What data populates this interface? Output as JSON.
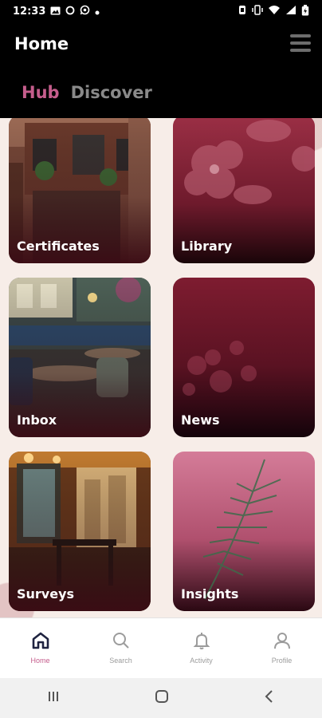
{
  "status_bar": {
    "time": "12:33",
    "left_icons": [
      "image-icon",
      "circle-icon",
      "whatsapp-icon",
      "dot-icon"
    ],
    "right_icons": [
      "alarm-icon",
      "vibrate-icon",
      "wifi-icon",
      "signal-icon",
      "battery-icon"
    ]
  },
  "header": {
    "title": "Home",
    "menu_icon": "hamburger-menu-icon"
  },
  "tabs": [
    {
      "label": "Hub",
      "active": true
    },
    {
      "label": "Discover",
      "active": false
    }
  ],
  "cards": [
    {
      "id": "certificates",
      "label": "Certificates"
    },
    {
      "id": "library",
      "label": "Library"
    },
    {
      "id": "inbox",
      "label": "Inbox"
    },
    {
      "id": "news",
      "label": "News"
    },
    {
      "id": "surveys",
      "label": "Surveys"
    },
    {
      "id": "insights",
      "label": "Insights"
    }
  ],
  "bottom_nav": [
    {
      "label": "Home",
      "icon": "home-icon",
      "active": true
    },
    {
      "label": "Search",
      "icon": "search-icon",
      "active": false
    },
    {
      "label": "Activity",
      "icon": "bell-icon",
      "active": false
    },
    {
      "label": "Profile",
      "icon": "person-icon",
      "active": false
    }
  ],
  "android_nav": [
    "recents-icon",
    "home-button-icon",
    "back-icon"
  ],
  "colors": {
    "accent": "#c55d8c",
    "header_bg": "#000000",
    "content_bg": "#f7ede8",
    "nav_active": "#1f2340"
  }
}
